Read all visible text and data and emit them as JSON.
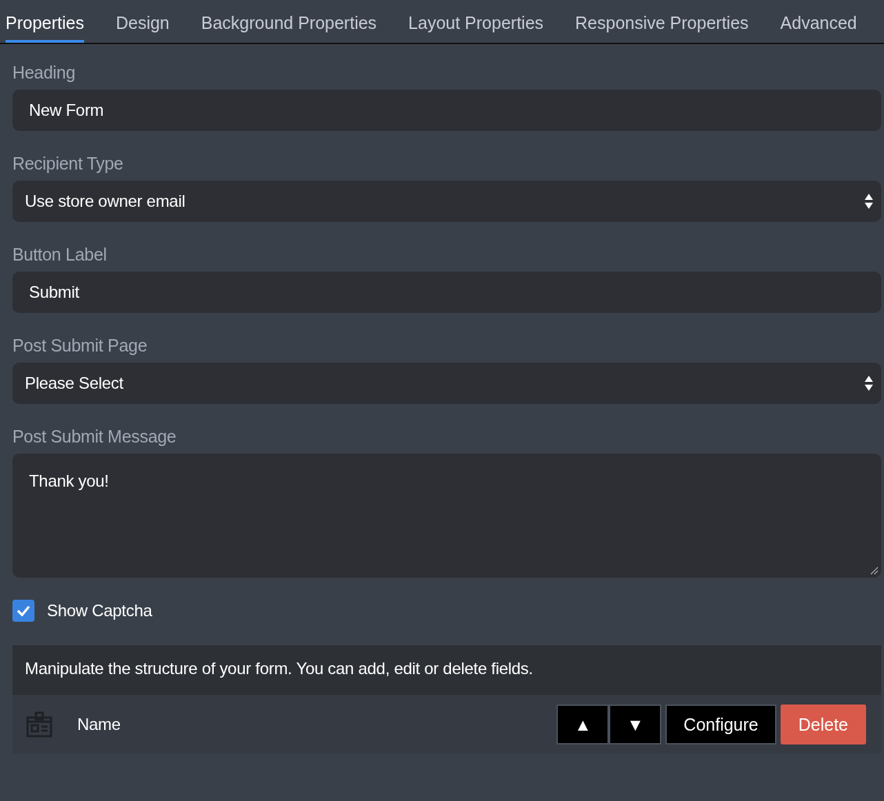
{
  "tabs": [
    {
      "label": "Properties",
      "selected": true
    },
    {
      "label": "Design",
      "selected": false
    },
    {
      "label": "Background Properties",
      "selected": false
    },
    {
      "label": "Layout Properties",
      "selected": false
    },
    {
      "label": "Responsive Properties",
      "selected": false
    },
    {
      "label": "Advanced",
      "selected": false
    }
  ],
  "fields": [
    {
      "kind": "text",
      "label": "Heading",
      "value": "New Form"
    },
    {
      "kind": "select",
      "label": "Recipient Type",
      "value": "Use store owner email"
    },
    {
      "kind": "text",
      "label": "Button Label",
      "value": "Submit"
    },
    {
      "kind": "select",
      "label": "Post Submit Page",
      "value": "Please Select"
    },
    {
      "kind": "textarea",
      "label": "Post Submit Message",
      "value": "Thank you!"
    }
  ],
  "captcha": {
    "label": "Show Captcha",
    "checked": true
  },
  "structure": {
    "description": "Manipulate the structure of your form. You can add, edit or delete fields.",
    "rows": [
      {
        "name": "Name",
        "buttons": [
          "▲",
          "▼",
          "Configure",
          "Delete"
        ]
      }
    ]
  }
}
